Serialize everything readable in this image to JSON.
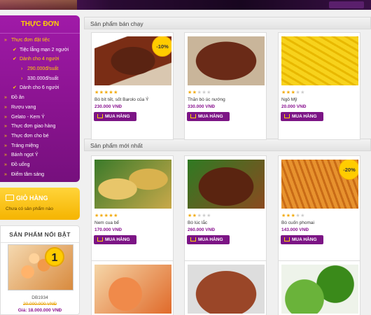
{
  "menu": {
    "title": "THỰC ĐƠN",
    "items": [
      {
        "label": "Thực đơn đặt tiệc",
        "level": 0,
        "marker": "»",
        "active": true
      },
      {
        "label": "Tiệc lẵng mạn 2 người",
        "level": 1,
        "marker": "✔",
        "active": false
      },
      {
        "label": "Dành cho 4 người",
        "level": 1,
        "marker": "✔",
        "active": true
      },
      {
        "label": "290.000đ/suất",
        "level": 2,
        "marker": "›",
        "active": true
      },
      {
        "label": "330.000đ/suất",
        "level": 2,
        "marker": "›",
        "active": false
      },
      {
        "label": "Dành cho 6 người",
        "level": 1,
        "marker": "✔",
        "active": false
      },
      {
        "label": "Đồ ăn",
        "level": 0,
        "marker": "»",
        "active": false
      },
      {
        "label": "Rượu vang",
        "level": 0,
        "marker": "»",
        "active": false
      },
      {
        "label": "Gelato - Kem Ý",
        "level": 0,
        "marker": "»",
        "active": false
      },
      {
        "label": "Thực đơn giao hàng",
        "level": 0,
        "marker": "»",
        "active": false
      },
      {
        "label": "Thực đơn cho bé",
        "level": 0,
        "marker": "»",
        "active": false
      },
      {
        "label": "Tráng miệng",
        "level": 0,
        "marker": "»",
        "active": false
      },
      {
        "label": "Bánh ngọt Ý",
        "level": 0,
        "marker": "»",
        "active": false
      },
      {
        "label": "Đồ uống",
        "level": 0,
        "marker": "»",
        "active": false
      },
      {
        "label": "Điểm tâm sáng",
        "level": 0,
        "marker": "»",
        "active": false
      }
    ]
  },
  "cart": {
    "title": "GIỎ HÀNG",
    "empty_text": "Chưa có sản phẩm nào"
  },
  "featured": {
    "title": "SẢN PHẨM NỔI BẬT",
    "rank": "1",
    "code": "DB1934",
    "old_price": "20.000.000 VNĐ",
    "new_price": "Giá: 18.000.000 VNĐ"
  },
  "sections": {
    "best": "Sản phẩm bán chạy",
    "new": "Sản phẩm mới nhất"
  },
  "buy_label": "MUA HÀNG",
  "best_products": [
    {
      "name": "Bò bít tết, sốt Barolo của Ý",
      "price": "230.000 VNĐ",
      "stars": 5,
      "badge": "-10%",
      "food": "ribs"
    },
    {
      "name": "Thăn bò úc nướng",
      "price": "330.000 VNĐ",
      "stars": 2,
      "badge": "",
      "food": "steak"
    },
    {
      "name": "Ngô Mỹ",
      "price": "20.000 VNĐ",
      "stars": 3,
      "badge": "",
      "food": "corn"
    }
  ],
  "new_products": [
    {
      "name": "Nem cua bể",
      "price": "170.000 VNĐ",
      "stars": 5,
      "badge": "",
      "food": "roll"
    },
    {
      "name": "Bò lúc lắc",
      "price": "260.000 VNĐ",
      "stars": 2,
      "badge": "",
      "food": "beef"
    },
    {
      "name": "Bò cuốn phomai",
      "price": "143.000 VNĐ",
      "stars": 3,
      "badge": "-20%",
      "food": "fries"
    }
  ],
  "partial_products": [
    {
      "food": "shrimp"
    },
    {
      "food": "chop"
    },
    {
      "food": "salad"
    }
  ],
  "colors": {
    "menu_bg": "#8a1390",
    "accent_yellow": "#ffd200",
    "price": "#8a1390",
    "star_on": "#f2a900"
  }
}
